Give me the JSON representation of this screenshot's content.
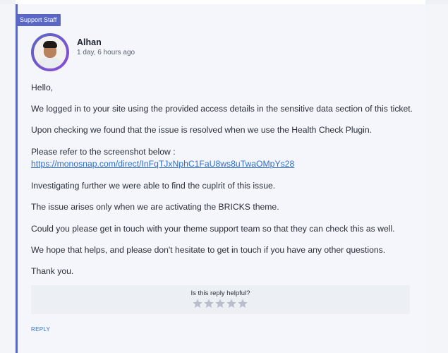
{
  "badge": {
    "label": "Support Staff"
  },
  "author": {
    "name": "Alhan",
    "timestamp": "1 day, 6 hours ago",
    "avatar_icon": "user-photo-avatar"
  },
  "message": {
    "greeting": "Hello,",
    "p1": "We logged in to your site using the provided access details in the sensitive data section of this ticket.",
    "p2": "Upon checking we found that the issue is resolved when we use the Health Check Plugin.",
    "p3": "Please refer to the screenshot below :",
    "link": "https://monosnap.com/direct/InFqTJxNphC1FaU8ws8uTwaOMpYs28",
    "p4": "Investigating further we were able to find the cuplrit of this issue.",
    "p5": "The issue arises only when we are activating the BRICKS theme.",
    "p6": "Could you please get in touch with your theme support team so that they can check this as well.",
    "p7": "We hope that helps, and please don't hesitate to get in touch if you have any other questions.",
    "closing": "Thank you."
  },
  "feedback": {
    "question": "Is this reply helpful?",
    "star_icon": "star-icon",
    "stars_total": 5,
    "rating": 0
  },
  "actions": {
    "reply_label": "REPLY"
  },
  "colors": {
    "accent": "#5a67c4",
    "link": "#2f6fcf",
    "star_inactive": "#b8bfcb"
  }
}
